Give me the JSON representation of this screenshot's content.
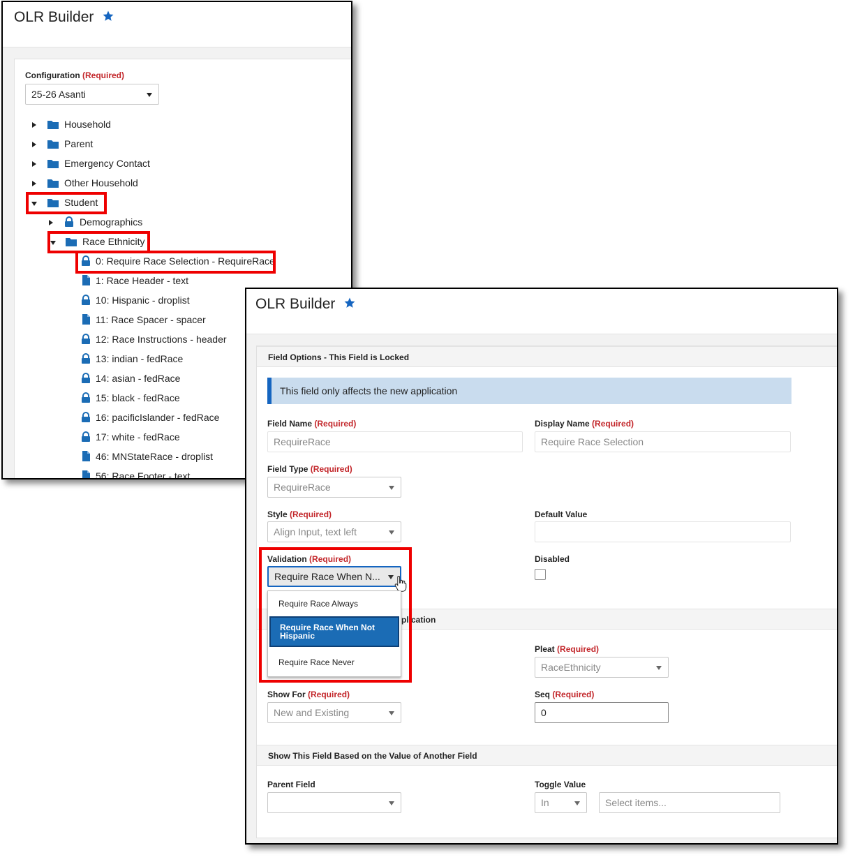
{
  "left_panel": {
    "title": "OLR Builder",
    "config_label": "Configuration",
    "required_tag": "(Required)",
    "config_value": "25-26 Asanti",
    "tree": {
      "household": "Household",
      "parent": "Parent",
      "emergency": "Emergency Contact",
      "other_household": "Other Household",
      "student": "Student",
      "demographics": "Demographics",
      "race_ethnicity": "Race Ethnicity",
      "fields": [
        {
          "label": "0: Require Race Selection - RequireRace",
          "icon": "lock-icon"
        },
        {
          "label": "1: Race Header - text",
          "icon": "file-icon"
        },
        {
          "label": "10: Hispanic - droplist",
          "icon": "lock-icon"
        },
        {
          "label": "11: Race Spacer - spacer",
          "icon": "file-icon"
        },
        {
          "label": "12: Race Instructions - header",
          "icon": "lock-icon"
        },
        {
          "label": "13: indian - fedRace",
          "icon": "lock-icon"
        },
        {
          "label": "14: asian - fedRace",
          "icon": "lock-icon"
        },
        {
          "label": "15: black - fedRace",
          "icon": "lock-icon"
        },
        {
          "label": "16: pacificIslander - fedRace",
          "icon": "lock-icon"
        },
        {
          "label": "17: white - fedRace",
          "icon": "lock-icon"
        },
        {
          "label": "46: MNStateRace - droplist",
          "icon": "file-icon"
        },
        {
          "label": "56: Race Footer - text",
          "icon": "file-icon"
        }
      ]
    }
  },
  "right_panel": {
    "title": "OLR Builder",
    "field_options_header": "Field Options - This Field is Locked",
    "info_banner": "This field only affects the new application",
    "required_tag": "(Required)",
    "field_name_label": "Field Name",
    "field_name_value": "RequireRace",
    "display_name_label": "Display Name",
    "display_name_value": "Require Race Selection",
    "field_type_label": "Field Type",
    "field_type_value": "RequireRace",
    "style_label": "Style",
    "style_value": "Align Input, text left",
    "default_value_label": "Default Value",
    "default_value_value": "",
    "validation_label": "Validation",
    "validation_value": "Require Race When N...",
    "validation_options": [
      "Require Race Always",
      "Require Race When Not Hispanic",
      "Require Race Never"
    ],
    "validation_selected_index": 1,
    "disabled_label": "Disabled",
    "placement_header_partial": "plication",
    "pleat_label": "Pleat",
    "pleat_value": "RaceEthnicity",
    "show_for_label": "Show For",
    "show_for_value": "New and Existing",
    "seq_label": "Seq",
    "seq_value": "0",
    "conditional_header": "Show This Field Based on the Value of Another Field",
    "parent_field_label": "Parent Field",
    "parent_field_value": "",
    "toggle_value_label": "Toggle Value",
    "toggle_operator": "In",
    "toggle_items_placeholder": "Select items..."
  },
  "colors": {
    "accent_blue": "#1565c0",
    "required_red": "#c3272b",
    "highlight_red": "#e00000",
    "info_banner_bg": "#c9dcee",
    "selected_option_bg": "#1b6cb5"
  }
}
